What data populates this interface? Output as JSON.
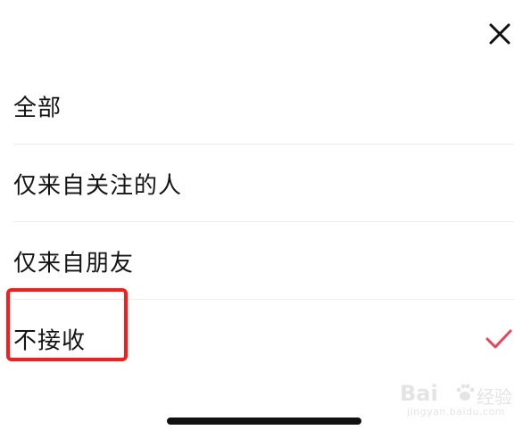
{
  "options": [
    {
      "label": "全部",
      "selected": false
    },
    {
      "label": "仅来自关注的人",
      "selected": false
    },
    {
      "label": "仅来自朋友",
      "selected": false
    },
    {
      "label": "不接收",
      "selected": true
    }
  ],
  "icons": {
    "close": "close-icon",
    "selected": "checkmark-icon"
  },
  "colors": {
    "check": "#e8455c",
    "highlight": "#ff1a1a",
    "text": "#141414"
  },
  "watermark": {
    "logo": "Bai",
    "cn": "经验",
    "url": "jingyan.baidu.com"
  }
}
